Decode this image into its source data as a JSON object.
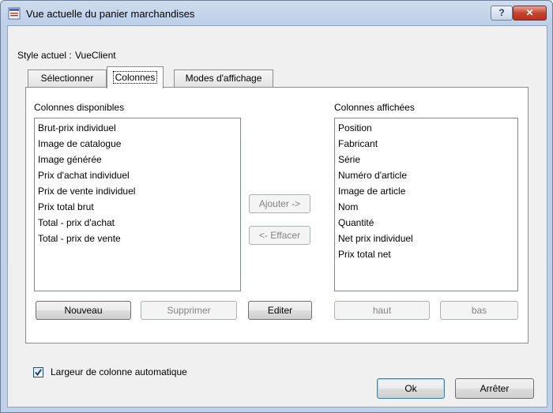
{
  "window": {
    "title": "Vue actuelle du panier marchandises",
    "help_label": "?",
    "close_label": "✕"
  },
  "style_line": {
    "label": "Style actuel :",
    "value": "VueClient"
  },
  "tabs": [
    {
      "label": "Sélectionner",
      "active": false
    },
    {
      "label": "Colonnes",
      "active": true
    },
    {
      "label": "Modes d'affichage",
      "active": false
    }
  ],
  "available": {
    "label": "Colonnes disponibles",
    "items": [
      "Brut-prix individuel",
      "Image de catalogue",
      "Image générée",
      "Prix d'achat individuel",
      "Prix de vente individuel",
      "Prix total brut",
      "Total - prix d'achat",
      "Total - prix de vente"
    ]
  },
  "displayed": {
    "label": "Colonnes affichées",
    "items": [
      "Position",
      "Fabricant",
      "Série",
      "Numéro d'article",
      "Image de article",
      "Nom",
      "Quantité",
      "Net prix individuel",
      "Prix total net"
    ]
  },
  "buttons": {
    "add": "Ajouter ->",
    "remove": "<- Effacer",
    "new": "Nouveau",
    "delete": "Supprimer",
    "edit": "Editer",
    "up": "haut",
    "down": "bas",
    "ok": "Ok",
    "stop": "Arrêter"
  },
  "auto_width": {
    "label": "Largeur de colonne automatique",
    "checked": true
  }
}
